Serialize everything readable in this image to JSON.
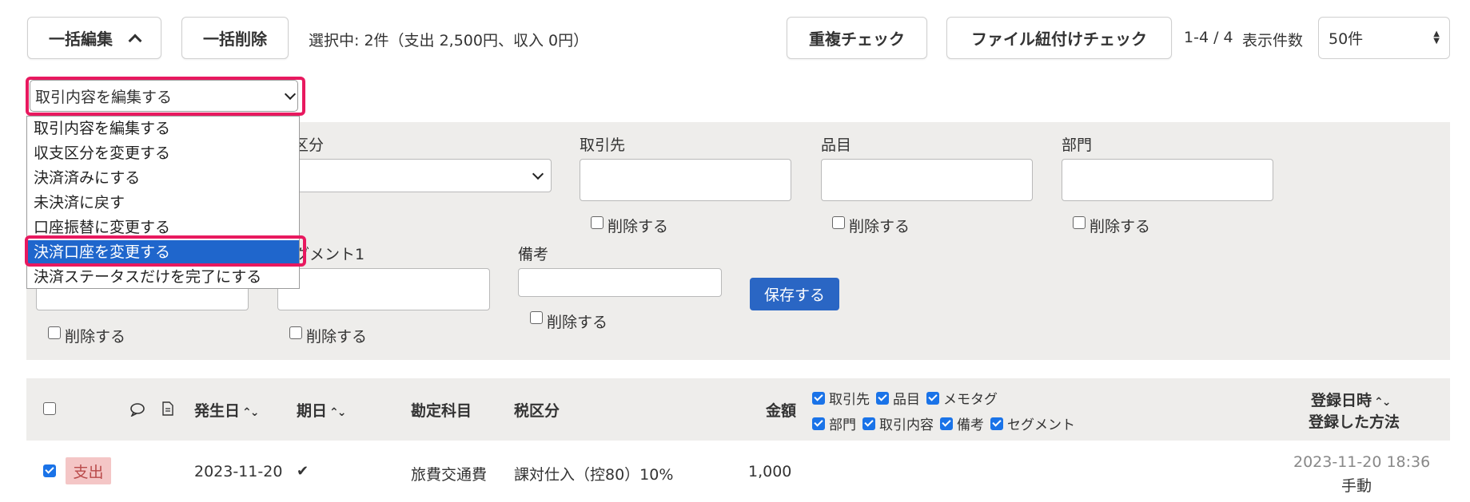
{
  "toolbar": {
    "bulk_edit_label": "一括編集",
    "bulk_delete_label": "一括削除",
    "selection_summary": "選択中: 2件（支出 2,500円、収入 0円）",
    "duplicate_check_label": "重複チェック",
    "file_link_check_label": "ファイル紐付けチェック",
    "range_text": "1-4 / 4",
    "per_page_label": "表示件数",
    "per_page_value": "50件"
  },
  "action_select": {
    "selected": "取引内容を編集する",
    "options": [
      "取引内容を編集する",
      "収支区分を変更する",
      "決済済みにする",
      "未決済に戻す",
      "口座振替に変更する",
      "決済口座を変更する",
      "決済ステータスだけを完了にする"
    ]
  },
  "form": {
    "partial_label_1": "区分",
    "partner_label": "取引先",
    "item_label": "品目",
    "department_label": "部門",
    "segment_partial_label": "グメント1",
    "note_label": "備考",
    "delete_label": "削除する",
    "save_label": "保存する"
  },
  "table": {
    "headers": {
      "date": "発生日",
      "due": "期日",
      "account": "勘定科目",
      "tax": "税区分",
      "amount": "金額",
      "registered_at": "登録日時",
      "registered_method": "登録した方法"
    },
    "column_options": [
      [
        "取引先",
        "品目",
        "メモタグ"
      ],
      [
        "部門",
        "取引内容",
        "備考",
        "セグメント"
      ]
    ],
    "rows": [
      {
        "type": "支出",
        "date": "2023-11-20",
        "due_check": "✔",
        "account": "旅費交通費",
        "tax": "課対仕入（控80）10%",
        "amount": "1,000",
        "registered_at": "2023-11-20 18:36",
        "registered_method": "手動"
      }
    ]
  },
  "colors": {
    "highlight": "#e8195f",
    "primary": "#2a66c4",
    "expense_badge_bg": "#f4c6c6",
    "panel_bg": "#eeedeb"
  }
}
